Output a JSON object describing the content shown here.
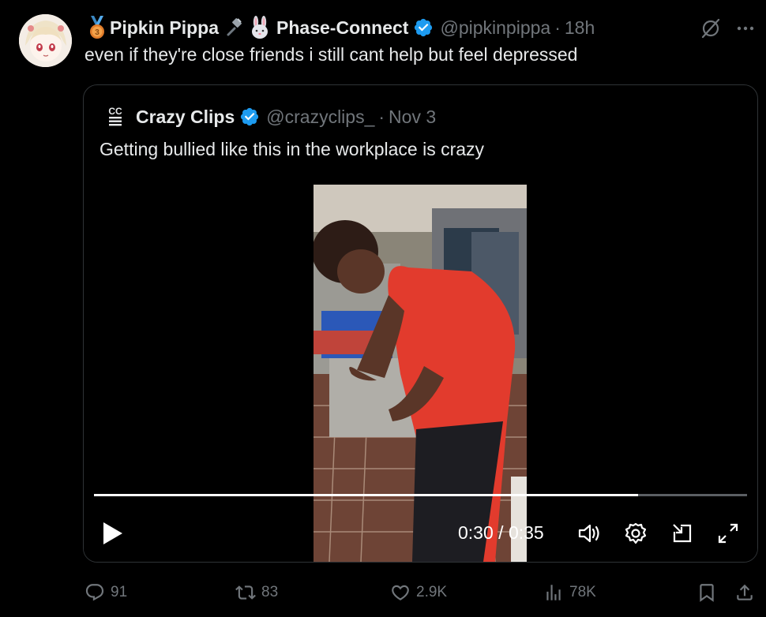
{
  "tweet": {
    "author": {
      "display_name_part1": "Pipkin Pippa",
      "display_name_part2": "Phase-Connect",
      "handle": "@pipkinpippa",
      "time": "18h"
    },
    "text": "even if they're close friends i still cant help but feel depressed"
  },
  "quote": {
    "author": {
      "display_name": "Crazy Clips",
      "handle": "@crazyclips_",
      "time": "Nov 3"
    },
    "text": "Getting bullied like this in the workplace is crazy",
    "video": {
      "current_time": "0:30",
      "separator": "/",
      "duration": "0:35",
      "progress": 0.833
    }
  },
  "actions": {
    "replies": "91",
    "reposts": "83",
    "likes": "2.9K",
    "views": "78K"
  },
  "colors": {
    "background": "#000000",
    "text_primary": "#e7e9ea",
    "text_secondary": "#71767b",
    "verified": "#1d9bf0",
    "border": "#2f3336"
  },
  "icons": [
    "medal-icon",
    "plug-icon",
    "rabbit-icon",
    "verified-badge-icon",
    "grok-icon",
    "more-icon",
    "play-icon",
    "volume-icon",
    "settings-icon",
    "pip-icon",
    "fullscreen-icon",
    "reply-icon",
    "repost-icon",
    "like-icon",
    "views-icon",
    "bookmark-icon",
    "share-icon"
  ]
}
